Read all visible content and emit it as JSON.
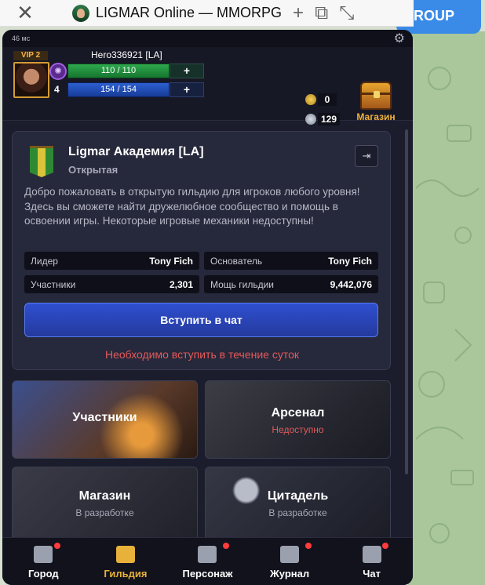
{
  "browser": {
    "title": "LIGMAR Online — MMORPG",
    "group_button": "ROUP"
  },
  "app": {
    "ping": "46 мс",
    "player": {
      "vip": "VIP 2",
      "name": "Hero336921 [LA]",
      "level": "4",
      "hp": "110 / 110",
      "mp": "154 / 154",
      "hp_plus": "+",
      "mp_plus": "+",
      "gold": "0",
      "silver": "129"
    },
    "shop_label": "Магазин",
    "guild": {
      "name": "Ligmar Академия [LA]",
      "type": "Открытая",
      "description": "Добро пожаловать в открытую гильдию для игроков любого уровня! Здесь вы сможете найти дружелюбное сообщество и помощь в освоении игры. Некоторые игровые механики недоступны!",
      "stats": [
        {
          "key": "Лидер",
          "value": "Tony Fich"
        },
        {
          "key": "Основатель",
          "value": "Tony Fich"
        },
        {
          "key": "Участники",
          "value": "2,301"
        },
        {
          "key": "Мощь гильдии",
          "value": "9,442,076"
        }
      ],
      "join_button": "Вступить в чат",
      "warning": "Необходимо вступить в течение суток"
    },
    "tiles": [
      {
        "title": "Участники",
        "subtitle": ""
      },
      {
        "title": "Арсенал",
        "subtitle": "Недоступно"
      },
      {
        "title": "Магазин",
        "subtitle": "В разработке"
      },
      {
        "title": "Цитадель",
        "subtitle": "В разработке"
      }
    ],
    "nav": [
      {
        "label": "Город",
        "icon": "castle-icon"
      },
      {
        "label": "Гильдия",
        "icon": "guild-banner-icon"
      },
      {
        "label": "Персонаж",
        "icon": "helmet-icon"
      },
      {
        "label": "Журнал",
        "icon": "book-icon"
      },
      {
        "label": "Чат",
        "icon": "chat-icon"
      }
    ],
    "colors": {
      "accent": "#e7b13a",
      "hp": "#2ea84d",
      "mp": "#2d5fd0",
      "join": "#2f4fcf",
      "warning": "#e45a5a"
    }
  }
}
